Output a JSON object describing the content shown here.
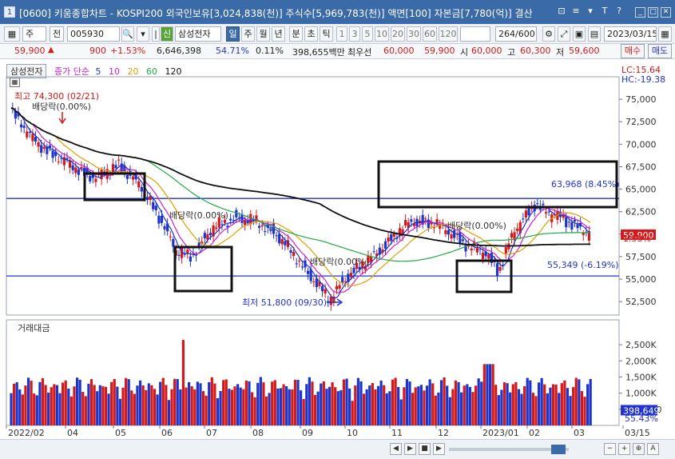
{
  "window": {
    "badge": "1",
    "title": "[0600] 키움종합차트 - KOSPI200 외국인보유[3,024,838(천)] 주식수[5,969,783(천)] 액면[100] 자본금[7,780(억)] 결산",
    "tools": [
      "⊡",
      "≡",
      "▾",
      "T",
      "?"
    ]
  },
  "toolbar": {
    "period": "주",
    "range_mode": "전",
    "code": "005930",
    "stock_name": "삼성전자",
    "periods": [
      "일",
      "주",
      "월",
      "년",
      "분",
      "초",
      "틱"
    ],
    "active_period": "일",
    "minutes": [
      "1",
      "3",
      "5",
      "10",
      "20",
      "30",
      "60",
      "120"
    ],
    "count": "264",
    "count_total": "/600",
    "date": "2023/03/15"
  },
  "quote": {
    "price": "59,900",
    "change": "900",
    "change_pct": "+1.53%",
    "volume": "6,646,398",
    "vol_ratio": "54.71%",
    "turnover": "0.11%",
    "amount": "398,655백만",
    "best_ask_label": "최우선",
    "best_ask": "60,000",
    "best_bid": "59,900",
    "open_label": "시",
    "open": "60,000",
    "high_label": "고",
    "high": "60,300",
    "low_label": "저",
    "low": "59,600",
    "buy_label": "매수",
    "sell_label": "매도"
  },
  "legend": {
    "stock": "삼성전자",
    "ma_label": "종가 단순",
    "ma": [
      {
        "period": "5",
        "color": "#2233cc"
      },
      {
        "period": "10",
        "color": "#cc22cc"
      },
      {
        "period": "20",
        "color": "#e0a000"
      },
      {
        "period": "60",
        "color": "#22aa44"
      },
      {
        "period": "120",
        "color": "#111111"
      }
    ]
  },
  "chart_data": {
    "type": "candlestick",
    "price_axis": [
      "75,000",
      "72,500",
      "70,000",
      "67,500",
      "65,000",
      "62,500",
      "60,000",
      "57,500",
      "55,000",
      "52,500"
    ],
    "ylim": [
      51000,
      77500
    ],
    "x_labels": [
      "2022/02",
      "04",
      "05",
      "06",
      "07",
      "08",
      "09",
      "10",
      "11",
      "12",
      "2023/01",
      "02",
      "03",
      "03/15"
    ],
    "current_price": "59,900",
    "current_pct": "1.53%",
    "lc": "LC:15.64",
    "hc": "HC:-19.38",
    "annotations": {
      "high": "최고 74,300 (02/21)",
      "low": "최저 51,800 (09/30)",
      "dividend": "배당락(0.00%)",
      "line_upper": "63,968 (8.45%)",
      "line_lower": "55,349 (-6.19%)"
    },
    "hlines": [
      63968,
      55349
    ],
    "volume_title": "거래대금",
    "volume_axis": [
      "2,500K",
      "2,000K",
      "1,500K",
      "1,000K",
      "500,000"
    ],
    "volume_ylim": [
      0,
      2900
    ],
    "volume_last": "398,649",
    "volume_pct": "55.43%"
  },
  "nav": [
    "◀",
    "▶",
    "■",
    "▶",
    "−",
    "+",
    "⊕",
    "A"
  ]
}
